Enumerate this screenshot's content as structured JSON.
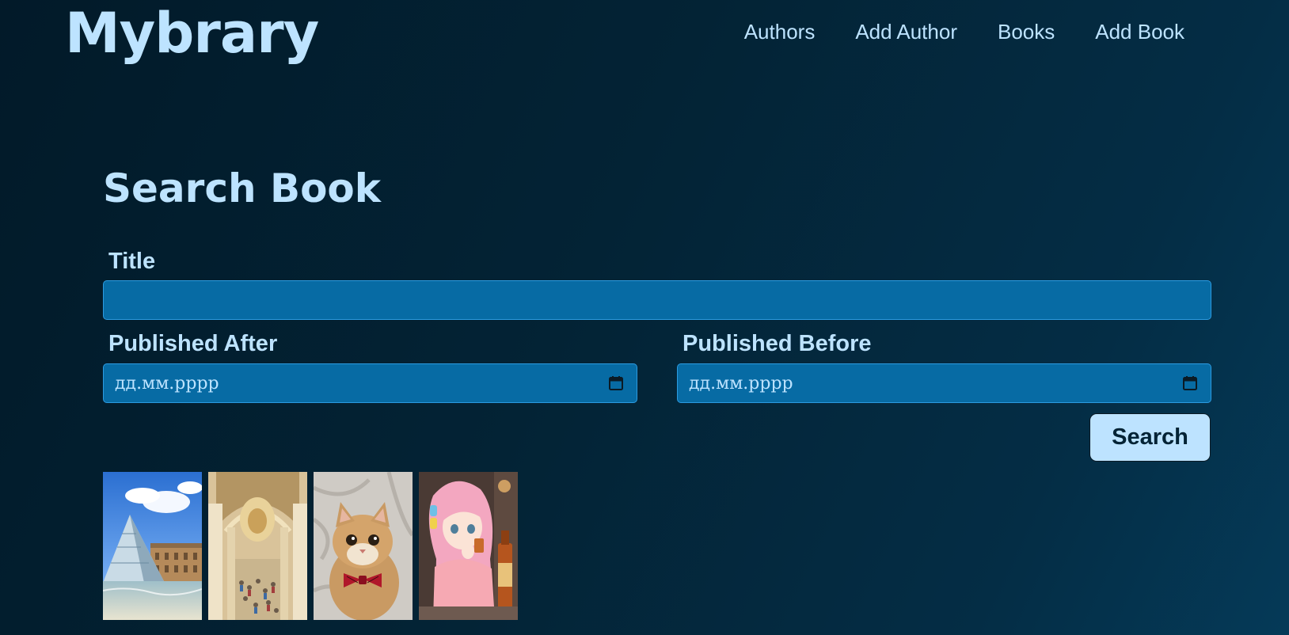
{
  "header": {
    "brand": "Mybrary",
    "nav": [
      {
        "label": "Authors"
      },
      {
        "label": "Add Author"
      },
      {
        "label": "Books"
      },
      {
        "label": "Add Book"
      }
    ]
  },
  "page": {
    "title": "Search Book"
  },
  "form": {
    "title_label": "Title",
    "title_value": "",
    "after_label": "Published After",
    "after_placeholder": "дд.мм.рррр",
    "before_label": "Published Before",
    "before_placeholder": "дд.мм.рррр",
    "search_label": "Search"
  },
  "results": {
    "covers": [
      {
        "icon": "louvre-pyramid-cover"
      },
      {
        "icon": "gallery-hall-cover"
      },
      {
        "icon": "cat-bowtie-cover"
      },
      {
        "icon": "anime-girl-cover"
      }
    ]
  },
  "colors": {
    "background": "#032335",
    "accent_text": "#bde3ff",
    "input_fill": "#076ba4",
    "input_border": "#2c9be0",
    "button_fill": "#bde3ff"
  }
}
